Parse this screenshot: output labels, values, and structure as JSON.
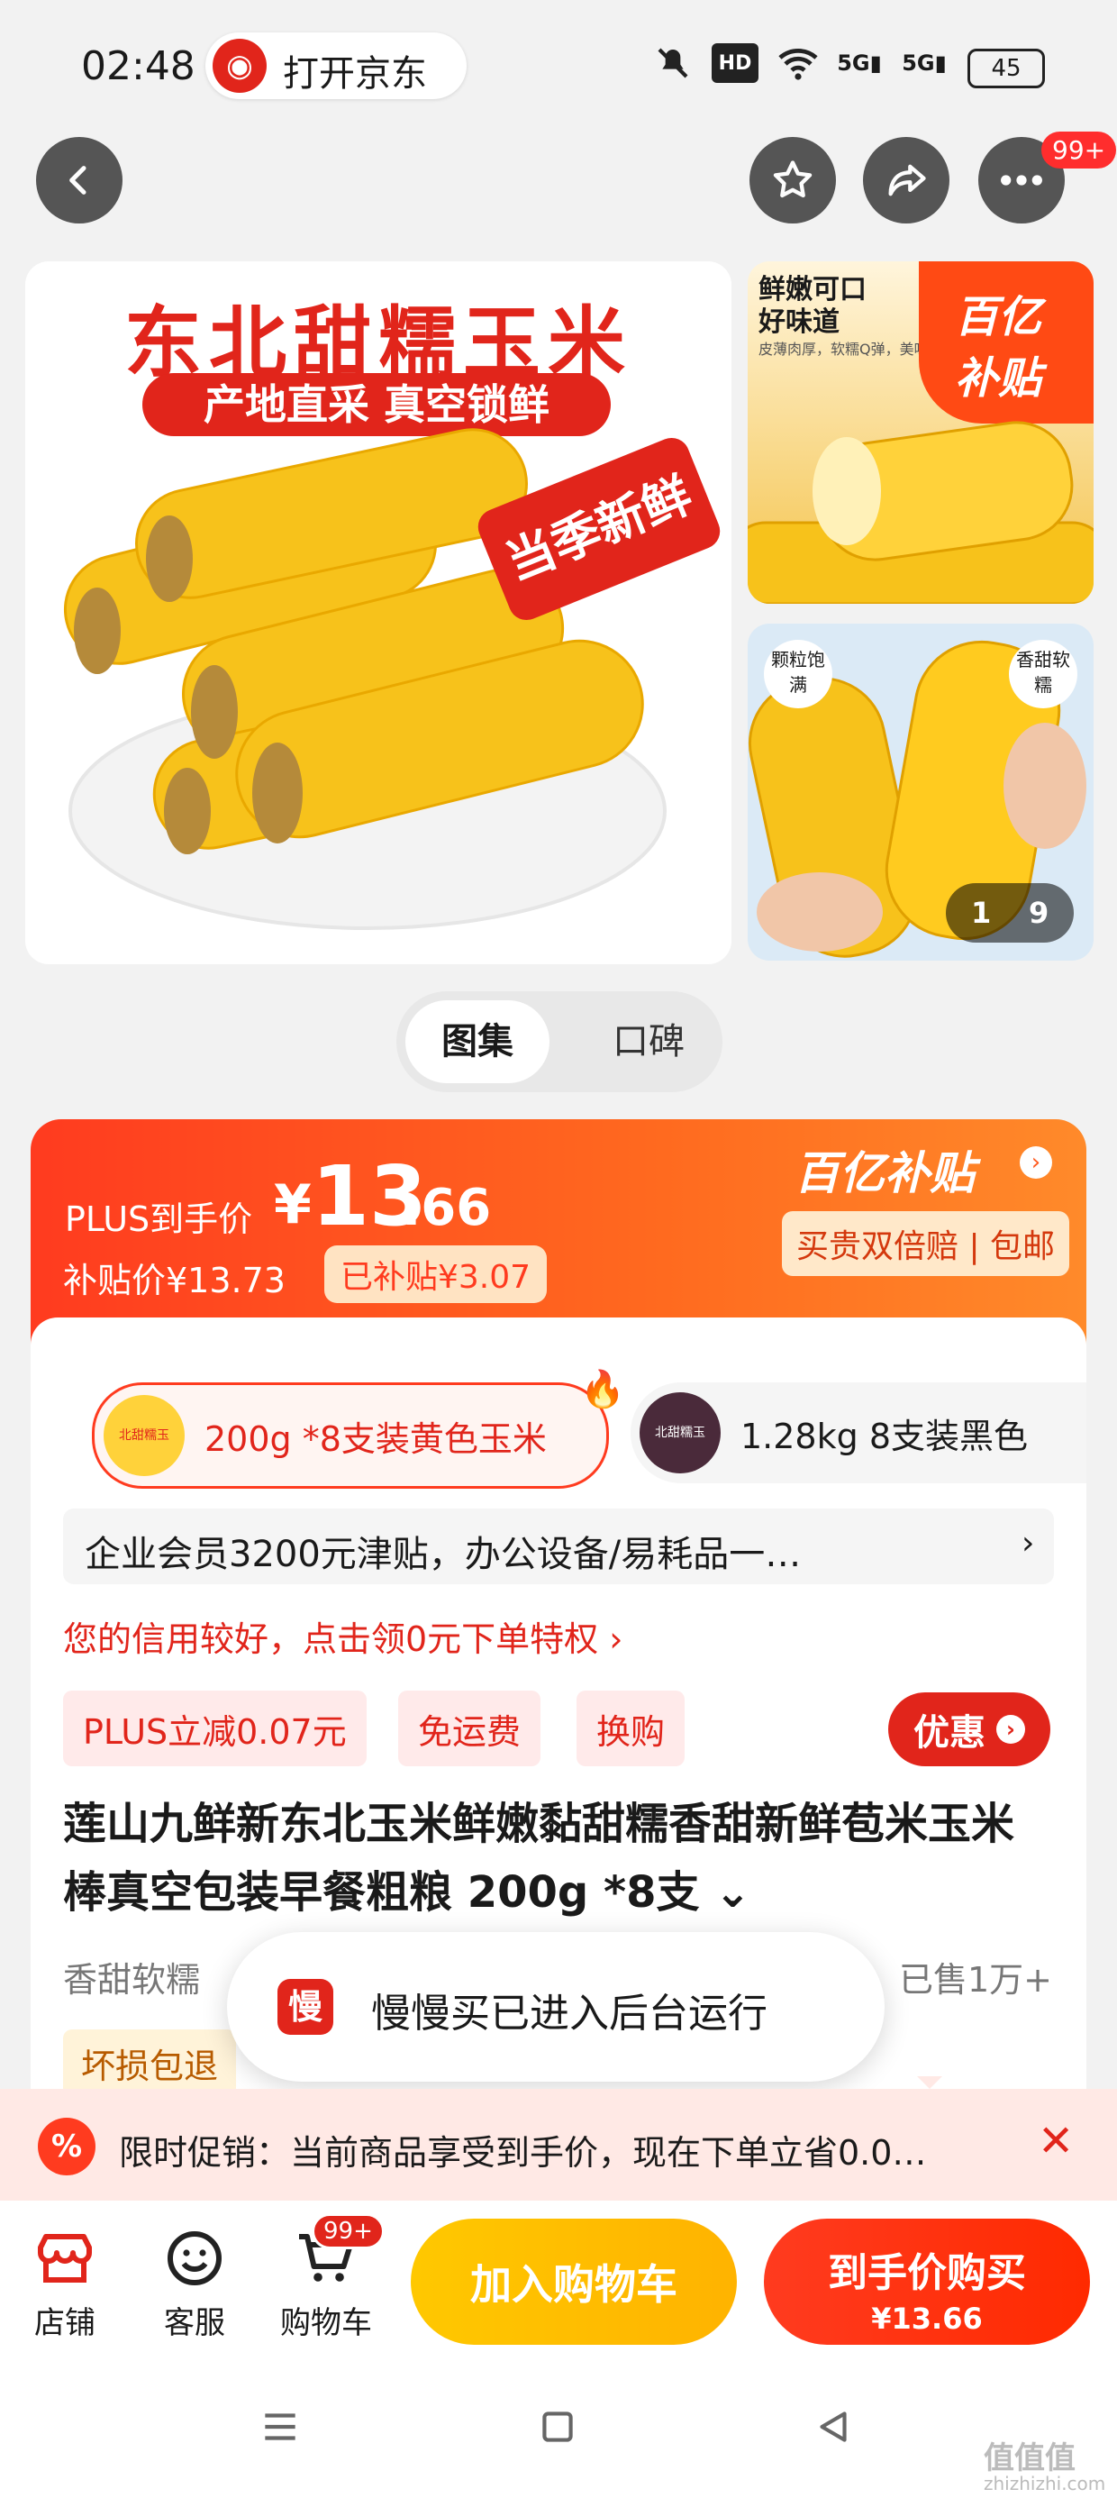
{
  "status_bar": {
    "time": "02:48",
    "open_app_label": "打开京东",
    "hd_label": "HD",
    "signal1": "5G",
    "signal2": "5G",
    "battery": "45"
  },
  "header": {
    "more_badge": "99+"
  },
  "gallery": {
    "main_title": "东北甜糯玉米",
    "main_subtitle": "产地直采 真空锁鲜",
    "main_stamp": "当季新鲜",
    "side1_text1": "鲜嫩可口",
    "side1_text2": "好味道",
    "side1_small": "皮薄肉厚，软糯Q弹，美味滋",
    "side1_badge_top": "百亿",
    "side1_badge_bottom": "补贴",
    "side2_tag_left": "颗粒饱满",
    "side2_tag_right": "香甜软糯",
    "side2_counter_current": "1",
    "side2_counter_total": "9"
  },
  "segment": {
    "active": "图集",
    "inactive": "口碑"
  },
  "price": {
    "plus_label": "PLUS到手价",
    "currency": "¥",
    "integer": "13",
    "decimal": ".66",
    "subsidy_price": "补贴价¥13.73",
    "subsidy_badge": "已补贴¥3.07",
    "brand_label": "百亿补贴",
    "guarantee": "买贵双倍赔 | 包邮"
  },
  "specs": [
    {
      "label": "200g *8支装黄色玉米",
      "thumb_text": "北甜糯玉"
    },
    {
      "label": "1.28kg 8支装黑色",
      "thumb_text": "北甜糯玉"
    }
  ],
  "member_bar": {
    "text": "企业会员3200元津贴，办公设备/易耗品一…",
    "chevron": "›"
  },
  "credit_text": "您的信用较好，点击领0元下单特权 ›",
  "tags": [
    "PLUS立减0.07元",
    "免运费",
    "换购"
  ],
  "youhui_label": "优惠",
  "product_title": "莲山九鲜新东北玉米鲜嫩黏甜糯香甜新鲜苞米玉米棒真空包装早餐粗粮 200g *8支 ⌄",
  "feature": "香甜软糯",
  "sold": "已售1万+",
  "damage": "坏损包退",
  "toast": {
    "icon_char": "慢",
    "text": "慢慢买已进入后台运行"
  },
  "promo": {
    "icon": "%",
    "text": "限时促销：当前商品享受到手价，现在下单立省0.0…",
    "close": "✕"
  },
  "bottom_bar": {
    "shop_label": "店铺",
    "service_label": "客服",
    "cart_label": "购物车",
    "cart_badge": "99+",
    "add_cart": "加入购物车",
    "buy_label": "到手价购买",
    "buy_price": "¥13.66"
  },
  "watermark": {
    "main": "值值值",
    "sub": "zhizhizhi.com"
  },
  "colors": {
    "jd_red": "#e1251b",
    "orange": "#ff6a1f",
    "yellow": "#ffc800",
    "corn": "#f7c21b"
  }
}
